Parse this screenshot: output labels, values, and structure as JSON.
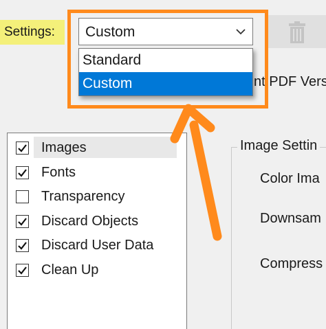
{
  "settings": {
    "label": "Settings:",
    "selected_value": "Custom",
    "options": [
      "Standard",
      "Custom"
    ],
    "highlighted_option": "Custom"
  },
  "toolbar": {
    "delete_icon": "trash-icon"
  },
  "compat_partial_text": "nt PDF Vers",
  "categories": [
    {
      "label": "Images",
      "checked": true,
      "selected": true
    },
    {
      "label": "Fonts",
      "checked": true
    },
    {
      "label": "Transparency",
      "checked": false
    },
    {
      "label": "Discard Objects",
      "checked": true
    },
    {
      "label": "Discard User Data",
      "checked": true
    },
    {
      "label": "Clean Up",
      "checked": true
    }
  ],
  "image_settings": {
    "title": "Image Settin",
    "color_label": "Color Ima",
    "downsample_label": "Downsam",
    "compress_label": "Compress"
  },
  "colors": {
    "highlight_yellow": "#f4f07a",
    "annotation_orange": "#ff8a1c",
    "selection_blue": "#0078d7"
  }
}
